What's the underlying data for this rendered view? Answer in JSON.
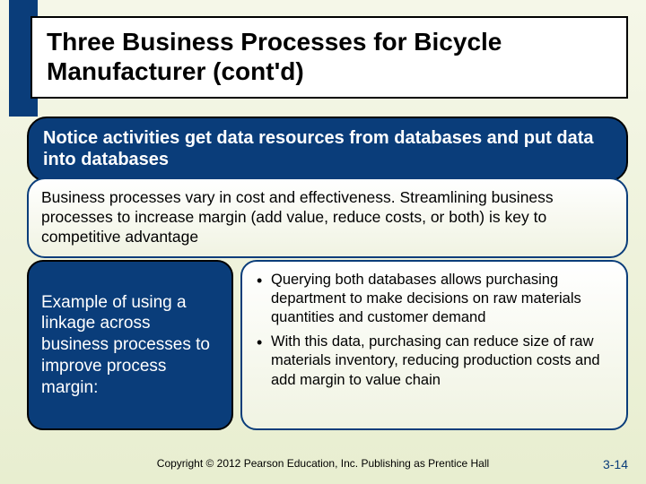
{
  "title": "Three Business Processes for Bicycle Manufacturer (cont'd)",
  "callout1": "Notice activities get data resources from databases and put data into databases",
  "callout2": "Business processes vary in cost and effectiveness. Streamlining business processes to increase margin (add value, reduce costs, or both) is key to competitive advantage",
  "example_label": "Example of using a linkage across business processes to improve process margin:",
  "bullets": {
    "b1": "Querying both databases allows purchasing department to make decisions on raw materials quantities and customer demand",
    "b2": "With this data, purchasing can reduce size of raw materials inventory, reducing production costs and add margin to value chain"
  },
  "copyright": "Copyright © 2012 Pearson Education, Inc. Publishing as Prentice Hall",
  "page_num": "3-14"
}
